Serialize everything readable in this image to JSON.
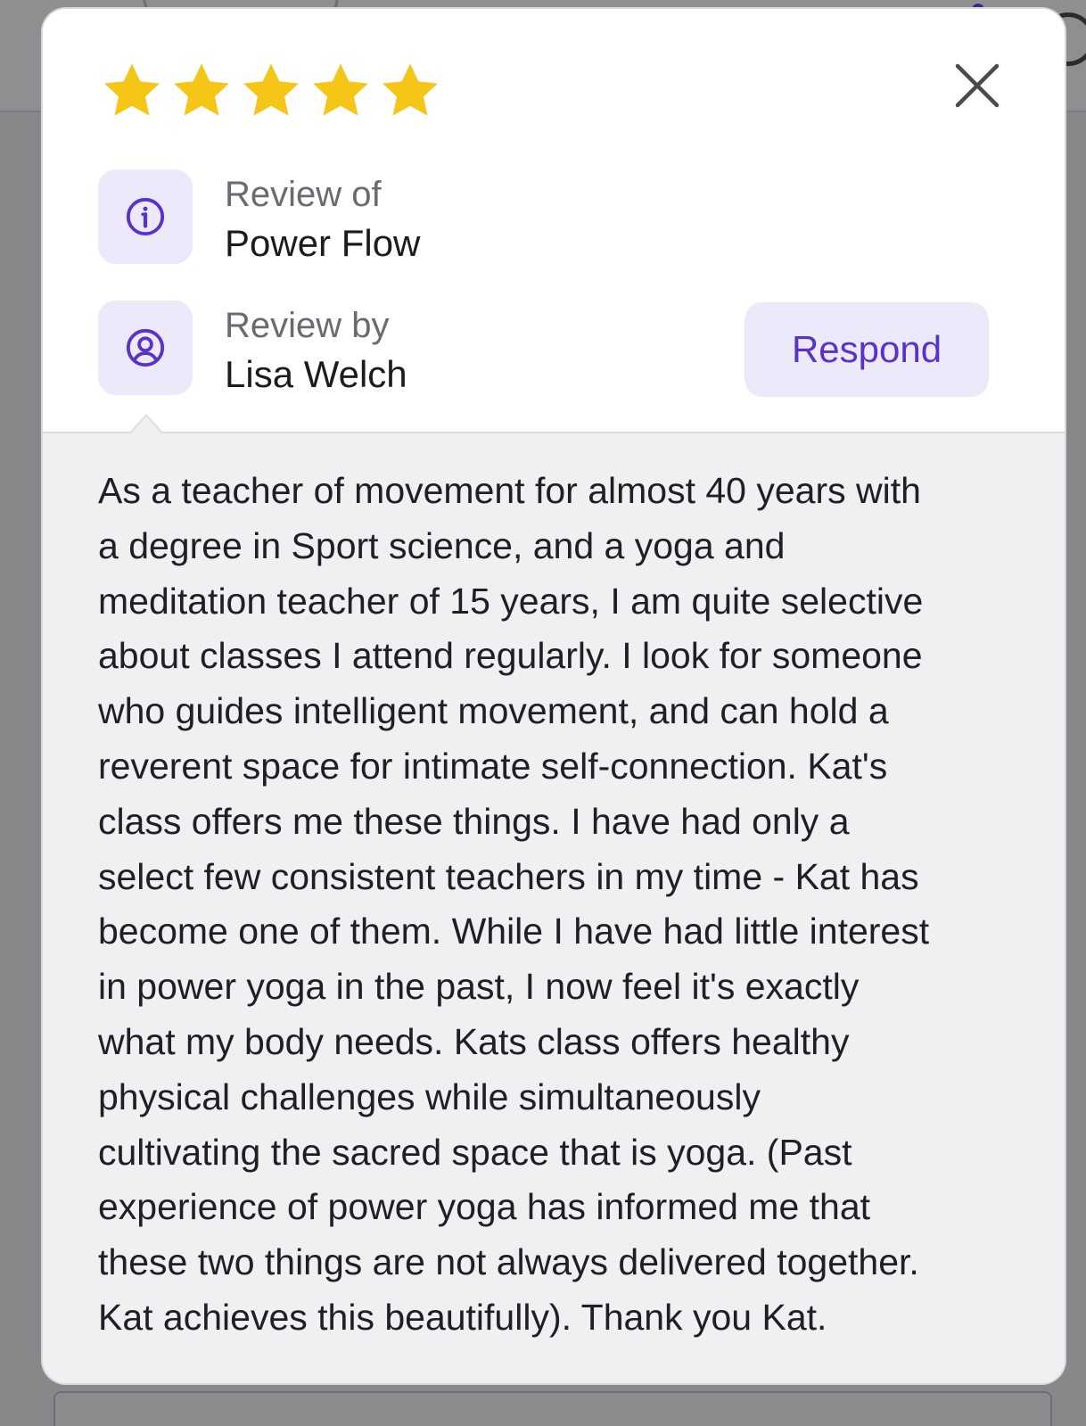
{
  "rating": {
    "value": 5,
    "max": 5,
    "color": "#f5c518"
  },
  "close": {
    "icon": "close-icon"
  },
  "review_of": {
    "label": "Review of",
    "value": "Power Flow",
    "icon": "info-icon"
  },
  "review_by": {
    "label": "Review by",
    "value": "Lisa Welch",
    "icon": "user-circle-icon"
  },
  "respond_button": {
    "label": "Respond"
  },
  "review": {
    "lines": [
      "As a teacher of movement for almost 40 years with",
      "a degree in Sport science, and a yoga and",
      "meditation teacher of 15 years, I am quite selective",
      "about classes I attend regularly. I look for someone",
      "who guides intelligent movement, and can hold a",
      "reverent space for intimate self-connection. Kat's",
      "class offers me these things. I have had only a",
      "select few consistent teachers in my time - Kat has",
      "become one of them. While I have had little interest",
      "in power yoga in the past, I now feel it's exactly",
      "what my body needs. Kats class offers healthy",
      "physical challenges while simultaneously",
      "cultivating the sacred space that is yoga. (Past",
      "experience of power yoga has informed me that",
      "these two things are not always delivered together.",
      "Kat achieves this beautifully). Thank you Kat."
    ]
  },
  "colors": {
    "accent": "#5b32c9",
    "accent_bg": "#ece9fb",
    "panel_bg": "#f0f0f2"
  }
}
